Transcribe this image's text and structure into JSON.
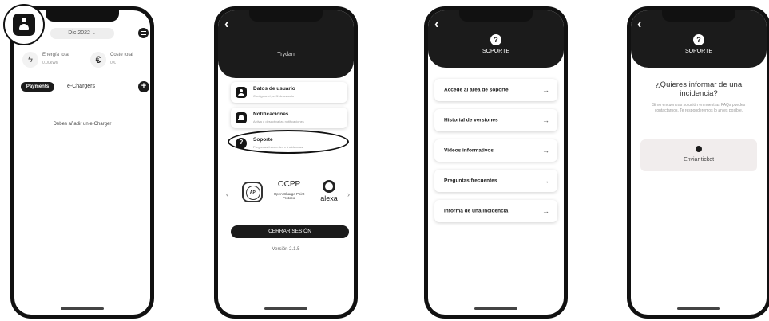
{
  "screen1": {
    "month": "Dic 2022",
    "energy_label": "Energía total",
    "energy_value": "0.00kWh",
    "cost_label": "Coste total",
    "cost_value": "0 €",
    "payments_label": "Payments",
    "chargers_label": "e-Chargers",
    "empty_message": "Debes añadir un e-Charger",
    "energy_icon": "lightning-icon",
    "cost_icon": "euro-icon"
  },
  "screen2": {
    "user_name": "Trydan",
    "items": [
      {
        "title": "Datos de usuario",
        "subtitle": "Configura el perfil de usuario"
      },
      {
        "title": "Notificaciones",
        "subtitle": "Activa o desactiva las notificaciones"
      },
      {
        "title": "Soporte",
        "subtitle": "Preguntas frecuentes e incidencias"
      }
    ],
    "api_label": "API",
    "ocpp_title": "OCPP",
    "ocpp_subtitle": "Open Charge Point Protocol",
    "alexa_label": "alexa",
    "logout_label": "CERRAR SESIÓN",
    "version": "Versión 2.1.5"
  },
  "screen3": {
    "header_title": "SOPORTE",
    "items": [
      "Accede al área de soporte",
      "Historial de versiones",
      "Videos informativos",
      "Preguntas frecuentes",
      "Informa de una incidencia"
    ],
    "arrow_glyph": "→"
  },
  "screen4": {
    "header_title": "SOPORTE",
    "question": "¿Quieres informar de una incidencia?",
    "description": "Si no encuentras solución en nuestras FAQs puedes contactarnos. Te responderemos lo antes posible.",
    "button_label": "Enviar ticket"
  },
  "colors": {
    "dark": "#1b1b1b",
    "card_bg": "#ffffff",
    "ticket_bg": "#f1eded"
  }
}
